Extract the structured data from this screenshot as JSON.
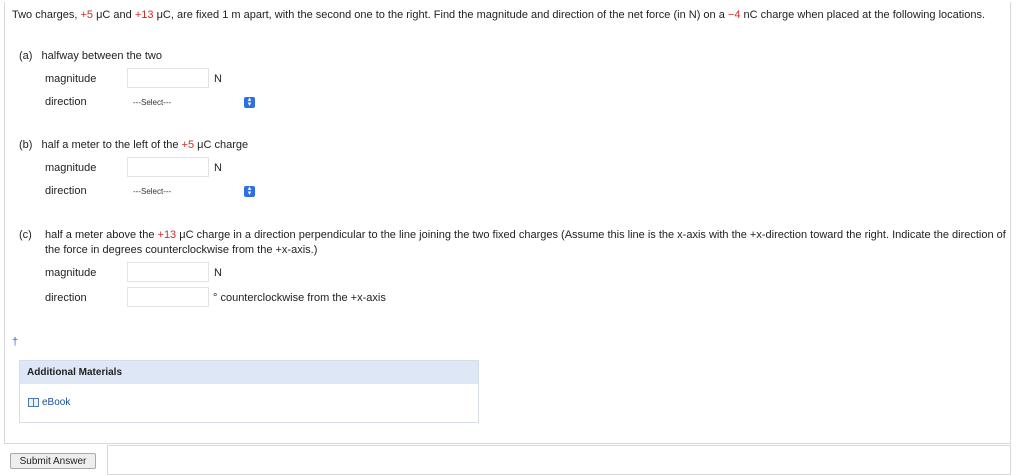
{
  "intro": {
    "t1": "Two charges, ",
    "q1": "+5",
    "t2": " μC and ",
    "q2": "+13",
    "t3": " μC, are fixed 1 m apart, with the second one to the right. Find the magnitude and direction of the net force (in N) on a ",
    "q3": "−4",
    "t4": " nC charge when placed at the following locations."
  },
  "parts": {
    "a": {
      "label": "(a)",
      "text": "halfway between the two",
      "magnitude_label": "magnitude",
      "magnitude_value": "",
      "magnitude_unit": "N",
      "direction_label": "direction",
      "direction_selected": "---Select---"
    },
    "b": {
      "label": "(b)",
      "t1": "half a meter to the left of the ",
      "q": "+5",
      "t2": " μC charge",
      "magnitude_label": "magnitude",
      "magnitude_value": "",
      "magnitude_unit": "N",
      "direction_label": "direction",
      "direction_selected": "---Select---"
    },
    "c": {
      "label": "(c)",
      "t1": "half a meter above the ",
      "q": "+13",
      "t2": " μC charge in a direction perpendicular to the line joining the two fixed charges (Assume this line is the x-axis with the +x-direction toward the right. Indicate the direction of the force in degrees counterclockwise from the +x-axis.)",
      "magnitude_label": "magnitude",
      "magnitude_value": "",
      "magnitude_unit": "N",
      "direction_label": "direction",
      "direction_value": "",
      "direction_unit": "° counterclockwise from the +x-axis"
    }
  },
  "dagger": "†",
  "additional_materials": {
    "title": "Additional Materials",
    "ebook": "eBook"
  },
  "submit_label": "Submit Answer",
  "colors": {
    "charge": "#d42a2a",
    "accent": "#2f6fe0",
    "panel_header": "#dde7f5"
  }
}
